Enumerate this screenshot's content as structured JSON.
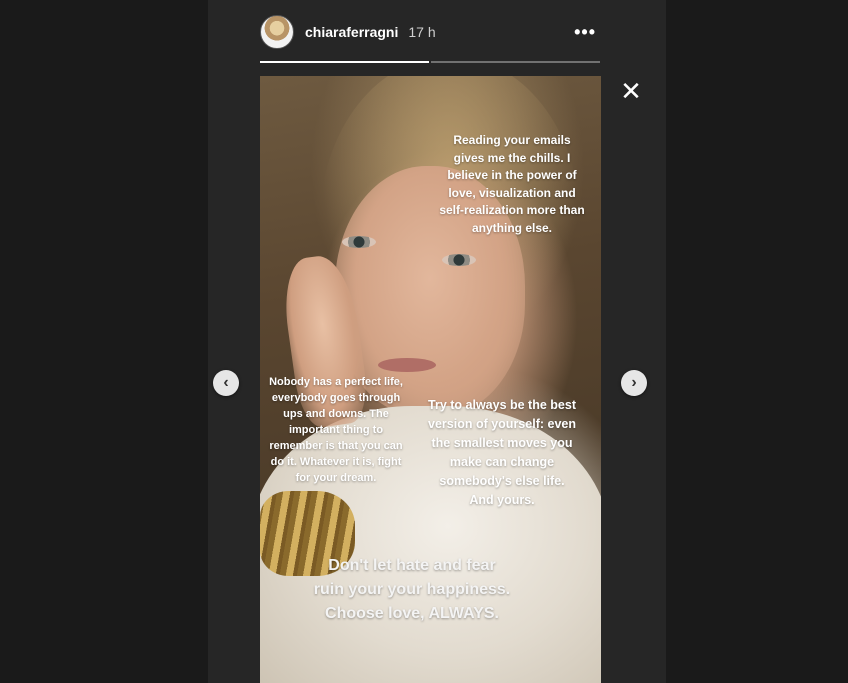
{
  "header": {
    "username": "chiaraferragni",
    "time": "17 h",
    "more_icon": "•••"
  },
  "progress": {
    "segments_total": 2,
    "segments_viewed": 1
  },
  "story": {
    "captions": {
      "emails": "Reading your emails gives me the chills. I believe in the power of love, visualization and self-realization more than anything else.",
      "nobody": "Nobody has a perfect life, everybody goes through ups and downs. The important thing to remember is that you can do it. Whatever it is, fight for your dream.",
      "try": "Try to always be the best version of yourself: even the smallest moves you make can change somebody's else life. And yours.",
      "hate": "Don't let hate and fear ruin your your happiness. Choose love, ALWAYS."
    }
  },
  "controls": {
    "close": "✕",
    "prev": "‹",
    "next": "›"
  },
  "icons": {
    "avatar": "profile-avatar",
    "more": "more-icon",
    "close": "close-icon",
    "prev": "chevron-left-icon",
    "next": "chevron-right-icon"
  },
  "colors": {
    "background": "#1a1a1a",
    "panel": "#262626",
    "text": "#ffffff"
  }
}
